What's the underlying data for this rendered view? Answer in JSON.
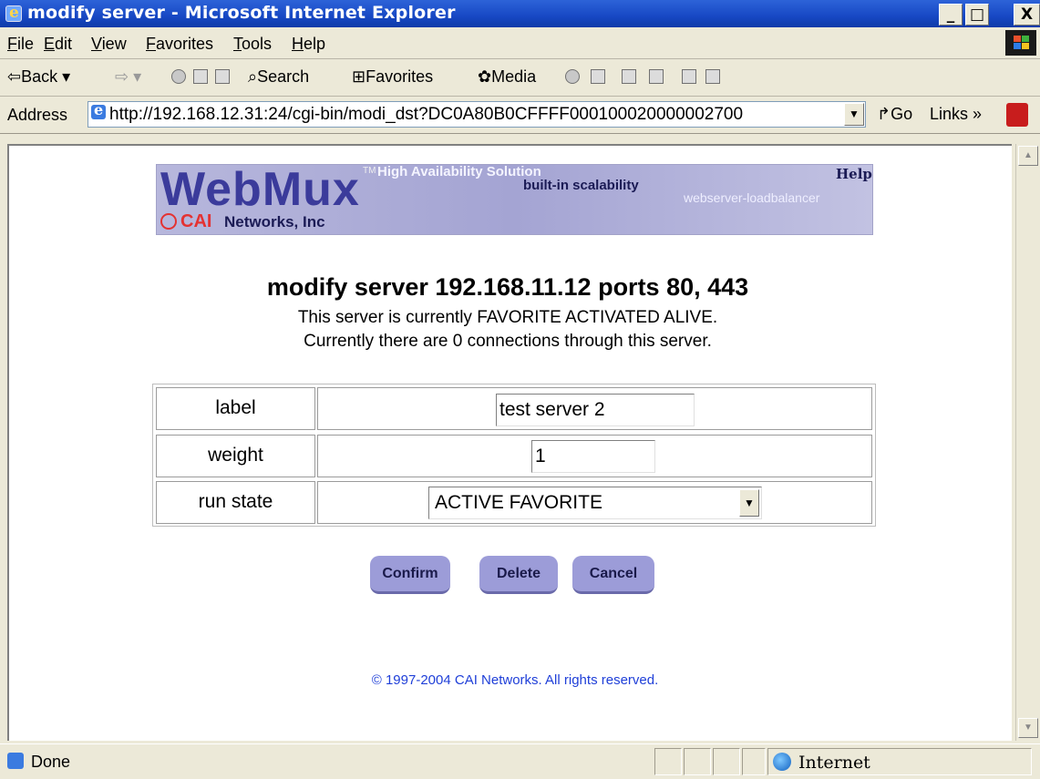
{
  "window": {
    "title": "modify server - Microsoft Internet Explorer",
    "min": "_",
    "max": "□",
    "close": "X"
  },
  "menu": [
    "File",
    "Edit",
    "View",
    "Favorites",
    "Tools",
    "Help"
  ],
  "toolbar": {
    "back": "Back",
    "search": "Search",
    "favorites": "Favorites",
    "media": "Media"
  },
  "address": {
    "label": "Address",
    "url": "http://192.168.12.31:24/cgi-bin/modi_dst?DC0A80B0CFFFF000100020000002700",
    "go": "Go",
    "links": "Links"
  },
  "banner": {
    "logo": "WebMux",
    "tm": "TM",
    "tagline": "High Availability Solution",
    "subtag": "built-in scalability",
    "loadbalancer": "webserver-loadbalancer",
    "help": "Help",
    "company_a": "CAI",
    "company_b": "Networks, Inc"
  },
  "page": {
    "heading": "modify server 192.168.11.12 ports 80, 443",
    "status_line": "This server is currently FAVORITE ACTIVATED ALIVE.",
    "connections_line": "Currently there are 0 connections through this server."
  },
  "form": {
    "label_label": "label",
    "label_value": "test server 2",
    "weight_label": "weight",
    "weight_value": "1",
    "runstate_label": "run state",
    "runstate_value": "ACTIVE FAVORITE"
  },
  "buttons": {
    "confirm": "Confirm",
    "delete": "Delete",
    "cancel": "Cancel"
  },
  "footer": {
    "copyright": "© 1997-2004 CAI Networks. All rights reserved."
  },
  "statusbar": {
    "status": "Done",
    "zone": "Internet"
  }
}
